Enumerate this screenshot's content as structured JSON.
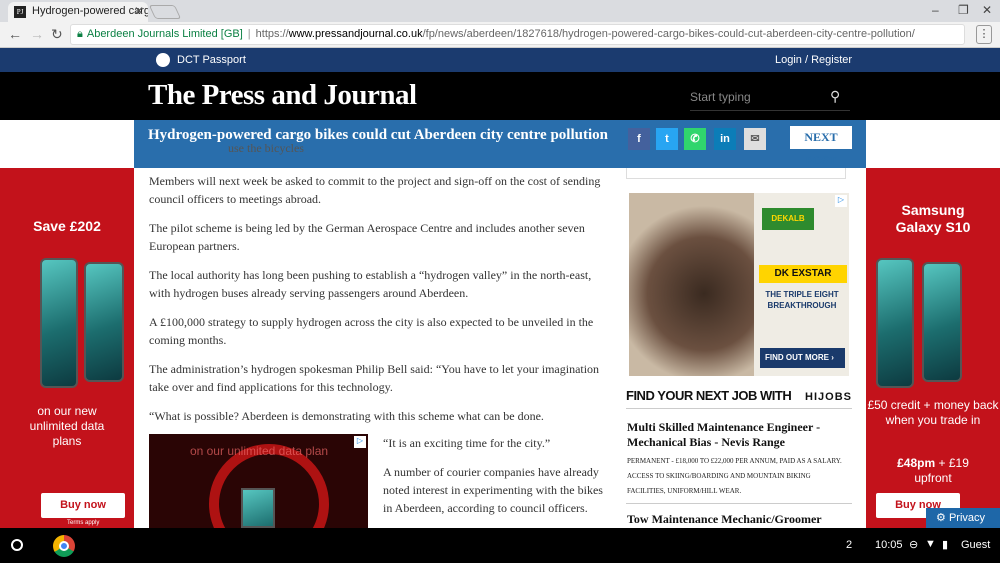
{
  "browser": {
    "tab_title": "Hydrogen-powered cargo",
    "favicon_text": "PJ",
    "secure_label": "Aberdeen Journals Limited [GB]",
    "url_scheme": "https://",
    "url_host": "www.pressandjournal.co.uk",
    "url_path": "/fp/news/aberdeen/1827618/hydrogen-powered-cargo-bikes-could-cut-aberdeen-city-centre-pollution/"
  },
  "topstrip": {
    "passport": "DCT Passport",
    "login": "Login / Register"
  },
  "masthead": {
    "logo": "The Press and Journal",
    "search_placeholder": "Start typing"
  },
  "sticky": {
    "title": "Hydrogen-powered cargo bikes could cut Aberdeen city centre pollution",
    "next_post": "NEXT POST",
    "peek_text": "use the bicycles"
  },
  "article": {
    "paragraphs": [
      "Members will next week be asked to commit to the project and sign-off on the cost of sending council officers to meetings abroad.",
      "The pilot scheme is being led by the German Aerospace Centre and includes another seven European partners.",
      "The local authority has long been pushing to establish a “hydrogen valley” in the north-east, with hydrogen buses already serving passengers around Aberdeen.",
      "A £100,000 strategy to supply hydrogen across the city is also expected to be unveiled in the coming months.",
      "The administration’s hydrogen spokesman Philip Bell said: “You have to let your imagination take over and find applications for this technology.",
      "“What is possible? Aberdeen is demonstrating with this scheme what can be done."
    ],
    "side_paragraphs": [
      "“It is an exciting time for the city.”",
      "A number of courier companies have already noted interest in experimenting with the bikes in Aberdeen, according to council officers."
    ],
    "inline_ad_text": "on our unlimited data plan"
  },
  "ads": {
    "left_headline": "Save £202",
    "left_sub": "on our new unlimited data plans",
    "right_headline": "Samsung Galaxy S10",
    "right_sub": "£50 credit + money back when you trade in",
    "right_price": "£48pm",
    "right_price_extra": "+ £19 upfront",
    "buy_now": "Buy now",
    "terms": "Terms apply",
    "side_brand": "DEKALB",
    "side_product": "DK EXSTAR",
    "side_tagline": "THE TRIPLE EIGHT BREAKTHROUGH",
    "side_cta": "FIND OUT MORE"
  },
  "jobs": {
    "heading": "FIND YOUR NEXT JOB WITH",
    "brand": "HIJOBS",
    "items": [
      {
        "title": "Multi Skilled Maintenance Engineer - Mechanical Bias - Nevis Range",
        "desc": "PERMANENT - £18,000 TO £22,000 PER ANNUM, PAID AS A SALARY. ACCESS TO SKIING/BOARDING AND MOUNTAIN BIKING FACILITIES, UNIFORM/HILL WEAR."
      },
      {
        "title": "Tow Maintenance Mechanic/Groomer",
        "desc": ""
      }
    ]
  },
  "privacy": "Privacy",
  "shelf": {
    "notifications": "2",
    "time": "10:05",
    "user": "Guest"
  }
}
